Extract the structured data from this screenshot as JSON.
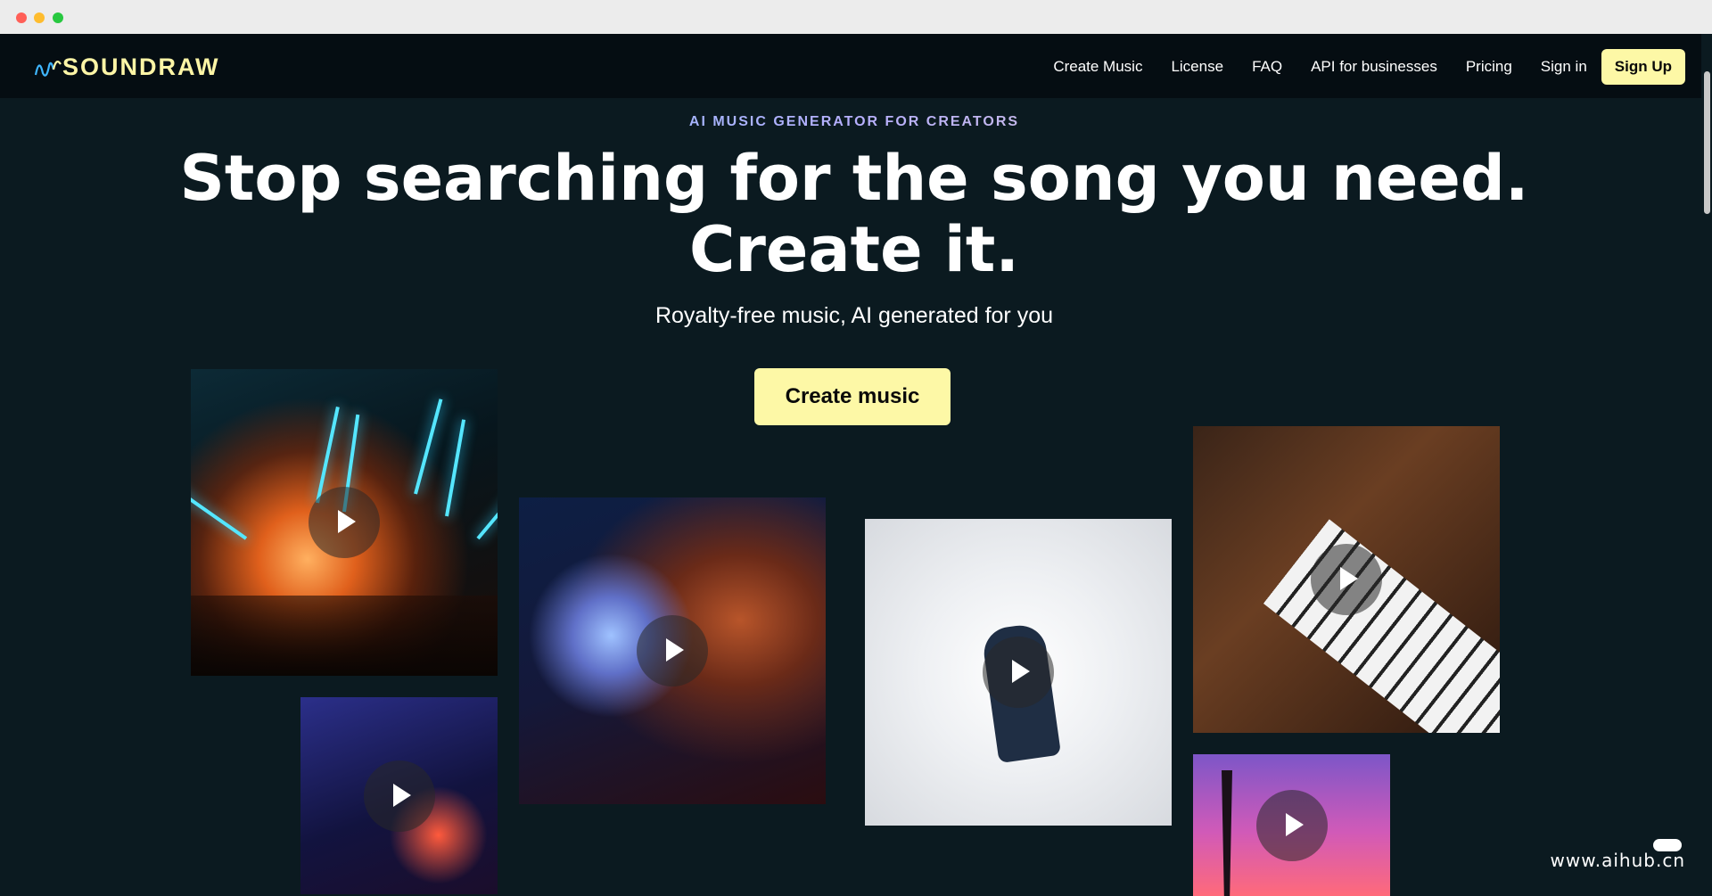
{
  "brand": {
    "name": "SOUNDRAW"
  },
  "nav": {
    "links": [
      "Create Music",
      "License",
      "FAQ",
      "API for businesses",
      "Pricing",
      "Sign in"
    ],
    "signup_label": "Sign Up"
  },
  "hero": {
    "eyebrow": "AI MUSIC GENERATOR FOR CREATORS",
    "headline_line1": "Stop searching for the song you need.",
    "headline_line2": "Create it.",
    "subhead": "Royalty-free music, AI generated for you",
    "cta_label": "Create music"
  },
  "tiles": [
    {
      "name": "concert",
      "icon": "play-icon"
    },
    {
      "name": "disco-ball",
      "icon": "play-icon"
    },
    {
      "name": "dancer",
      "icon": "play-icon"
    },
    {
      "name": "piano",
      "icon": "play-icon"
    },
    {
      "name": "city-night",
      "icon": "play-icon"
    },
    {
      "name": "palm-sunset",
      "icon": "play-icon"
    }
  ],
  "watermark": "www.aihub.cn",
  "colors": {
    "accent": "#fdf8a6",
    "background": "#0b1a20",
    "nav_bg": "#050d12"
  }
}
